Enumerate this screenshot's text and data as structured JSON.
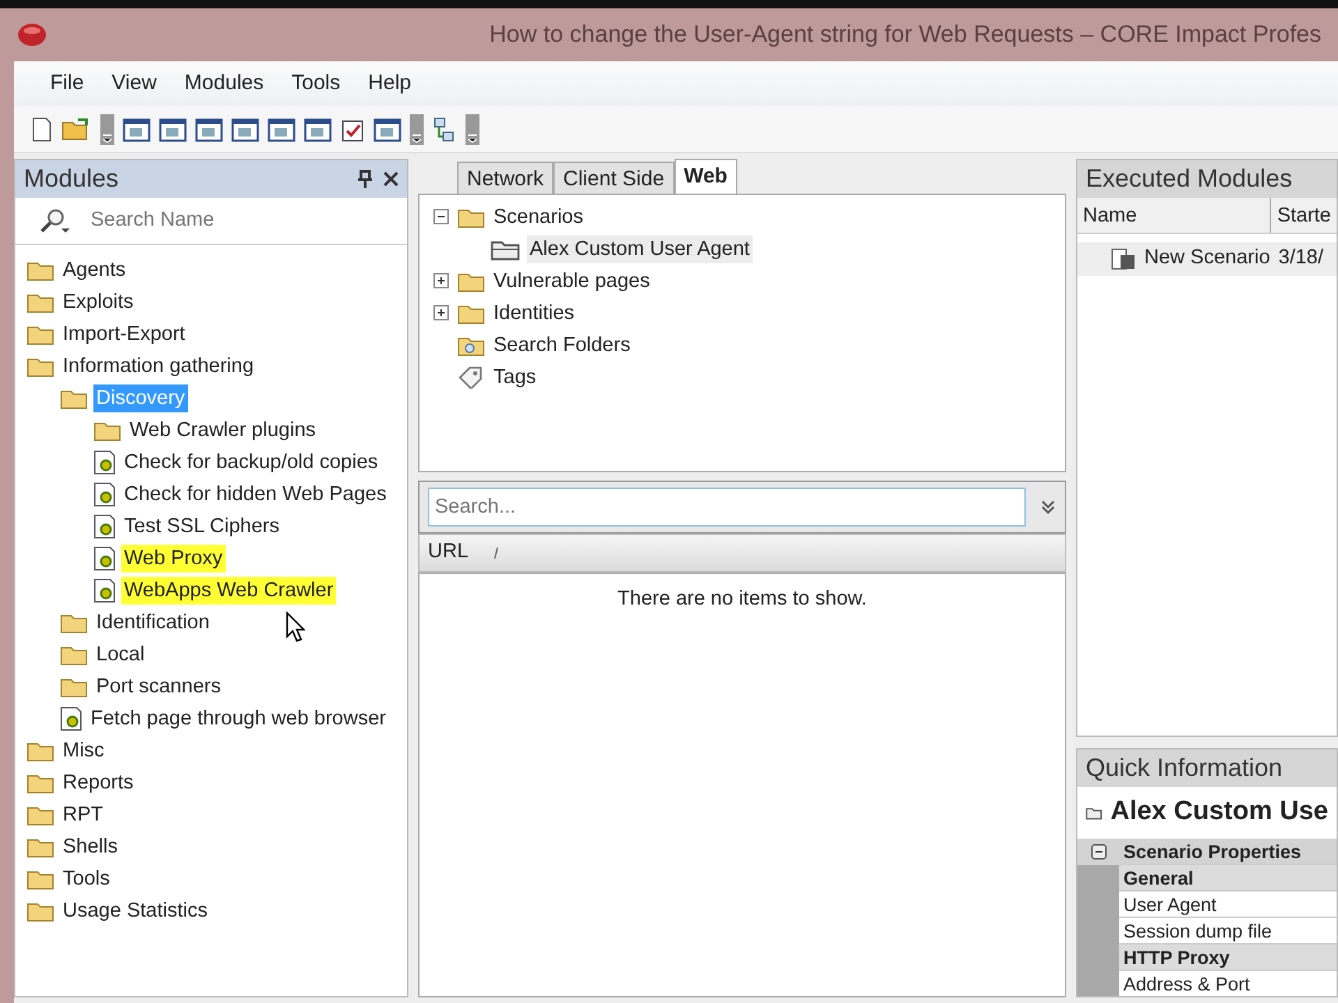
{
  "window": {
    "title": "How to change the User-Agent string for Web Requests – CORE Impact Profes"
  },
  "menu": [
    "File",
    "View",
    "Modules",
    "Tools",
    "Help"
  ],
  "modules_panel": {
    "title": "Modules",
    "search": {
      "placeholder": "Search Name"
    },
    "tree": [
      {
        "label": "Agents",
        "kind": "folder",
        "selected": false,
        "highlighted": false
      },
      {
        "label": "Exploits",
        "kind": "folder",
        "selected": false,
        "highlighted": false
      },
      {
        "label": "Import-Export",
        "kind": "folder",
        "selected": false,
        "highlighted": false
      },
      {
        "label": "Information gathering",
        "kind": "folder",
        "selected": false,
        "highlighted": false,
        "children": [
          {
            "label": "Discovery",
            "kind": "folder",
            "selected": true,
            "highlighted": false,
            "children": [
              {
                "label": "Web Crawler plugins",
                "kind": "folder",
                "selected": false,
                "highlighted": false
              },
              {
                "label": "Check for backup/old copies",
                "kind": "module",
                "selected": false,
                "highlighted": false
              },
              {
                "label": "Check for hidden Web Pages",
                "kind": "module",
                "selected": false,
                "highlighted": false
              },
              {
                "label": "Test SSL Ciphers",
                "kind": "module",
                "selected": false,
                "highlighted": false
              },
              {
                "label": "Web Proxy",
                "kind": "module",
                "selected": false,
                "highlighted": true
              },
              {
                "label": "WebApps Web Crawler",
                "kind": "module",
                "selected": false,
                "highlighted": true
              }
            ]
          },
          {
            "label": "Identification",
            "kind": "folder",
            "selected": false,
            "highlighted": false
          },
          {
            "label": "Local",
            "kind": "folder",
            "selected": false,
            "highlighted": false
          },
          {
            "label": "Port scanners",
            "kind": "folder",
            "selected": false,
            "highlighted": false
          },
          {
            "label": "Fetch page through web browser",
            "kind": "module",
            "selected": false,
            "highlighted": false
          }
        ]
      },
      {
        "label": "Misc",
        "kind": "folder",
        "selected": false,
        "highlighted": false
      },
      {
        "label": "Reports",
        "kind": "folder",
        "selected": false,
        "highlighted": false
      },
      {
        "label": "RPT",
        "kind": "folder",
        "selected": false,
        "highlighted": false
      },
      {
        "label": "Shells",
        "kind": "folder",
        "selected": false,
        "highlighted": false
      },
      {
        "label": "Tools",
        "kind": "folder",
        "selected": false,
        "highlighted": false
      },
      {
        "label": "Usage Statistics",
        "kind": "folder",
        "selected": false,
        "highlighted": false
      }
    ]
  },
  "workspace": {
    "tabs": [
      {
        "label": "Network",
        "selected": false
      },
      {
        "label": "Client Side",
        "selected": false
      },
      {
        "label": "Web",
        "selected": true
      }
    ],
    "tree": [
      {
        "label": "Scenarios",
        "kind": "folder",
        "expanded": true,
        "selected": false,
        "children": [
          {
            "label": "Alex Custom User Agent",
            "kind": "scenario",
            "selected": true
          }
        ]
      },
      {
        "label": "Vulnerable pages",
        "kind": "folder",
        "expanded": false,
        "selected": false
      },
      {
        "label": "Identities",
        "kind": "folder",
        "expanded": false,
        "selected": false
      },
      {
        "label": "Search Folders",
        "kind": "search-folder",
        "selected": false
      },
      {
        "label": "Tags",
        "kind": "tag",
        "selected": false
      }
    ],
    "search": {
      "placeholder": "Search..."
    },
    "list": {
      "columns": [
        "URL"
      ],
      "empty_text": "There are no items to show."
    }
  },
  "executed_modules": {
    "title": "Executed Modules",
    "columns": [
      "Name",
      "Starte"
    ],
    "rows": [
      [
        "New Scenario",
        "3/18/"
      ]
    ]
  },
  "quick_information": {
    "title": "Quick Information",
    "item": "Alex Custom Use",
    "properties": [
      {
        "label": "Scenario Properties",
        "kind": "section",
        "expanded": true
      },
      {
        "label": "General",
        "kind": "category"
      },
      {
        "label": "User Agent",
        "kind": "property"
      },
      {
        "label": "Session dump file",
        "kind": "property"
      },
      {
        "label": "HTTP Proxy",
        "kind": "category"
      },
      {
        "label": "Address & Port",
        "kind": "property"
      }
    ]
  }
}
